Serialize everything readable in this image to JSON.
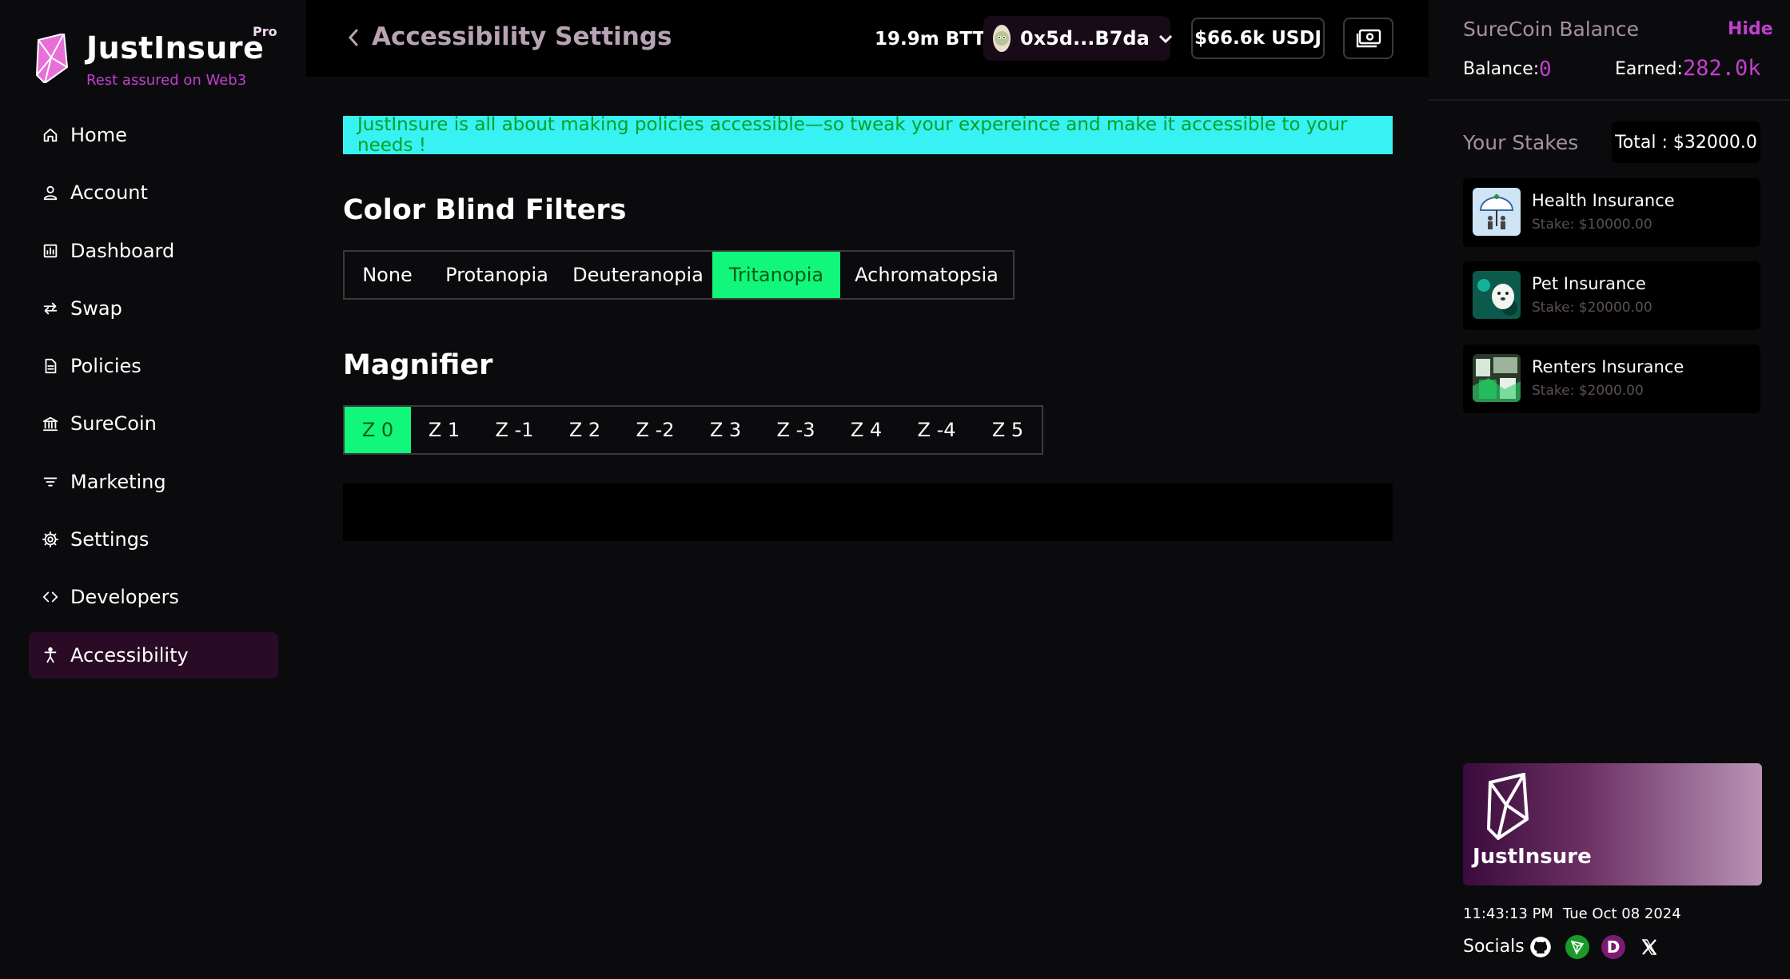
{
  "brand": {
    "name": "JustInsure",
    "badge": "Pro",
    "tagline": "Rest assured on Web3",
    "accent": "#c23fd0",
    "icon": "justinsure-logo-icon"
  },
  "sidebar": {
    "items": [
      {
        "label": "Home",
        "icon": "home-icon"
      },
      {
        "label": "Account",
        "icon": "user-icon"
      },
      {
        "label": "Dashboard",
        "icon": "dashboard-icon"
      },
      {
        "label": "Swap",
        "icon": "swap-icon"
      },
      {
        "label": "Policies",
        "icon": "document-icon"
      },
      {
        "label": "SureCoin",
        "icon": "bank-icon"
      },
      {
        "label": "Marketing",
        "icon": "filter-icon"
      },
      {
        "label": "Settings",
        "icon": "gear-icon"
      },
      {
        "label": "Developers",
        "icon": "code-icon"
      },
      {
        "label": "Accessibility",
        "icon": "accessibility-icon",
        "active": true
      }
    ]
  },
  "header": {
    "title": "Accessibility Settings",
    "btt_balance": "19.9m BTT",
    "wallet_address": "0x5d...B7da",
    "usdj_balance": "$66.6k USDJ"
  },
  "banner": {
    "text": "JustInsure is all about making policies accessible—so tweak your expereince and make it accessible to your needs !",
    "bg_color": "#38f1f3",
    "text_color": "#07a126"
  },
  "color_blind": {
    "title": "Color Blind Filters",
    "options": [
      "None",
      "Protanopia",
      "Deuteranopia",
      "Tritanopia",
      "Achromatopsia"
    ],
    "selected": "Tritanopia"
  },
  "magnifier": {
    "title": "Magnifier",
    "options": [
      "Z 0",
      "Z 1",
      "Z -1",
      "Z 2",
      "Z -2",
      "Z 3",
      "Z -3",
      "Z 4",
      "Z -4",
      "Z 5"
    ],
    "selected": "Z 0",
    "selected_color": "#11f77c"
  },
  "surecoin": {
    "title": "SureCoin Balance",
    "hide_label": "Hide",
    "balance_label": "Balance:",
    "balance_value": "0",
    "earned_label": "Earned:",
    "earned_value": "282.0k"
  },
  "stakes": {
    "title": "Your Stakes",
    "total": "Total : $32000.0",
    "items": [
      {
        "name": "Health Insurance",
        "amount": "Stake: $10000.00"
      },
      {
        "name": "Pet Insurance",
        "amount": "Stake: $20000.00"
      },
      {
        "name": "Renters Insurance",
        "amount": "Stake: $2000.00"
      }
    ]
  },
  "promo": {
    "name": "JustInsure"
  },
  "footer": {
    "time": "11:43:13 PM",
    "date": "Tue Oct 08 2024",
    "socials_label": "Socials",
    "socials": [
      "github-icon",
      "tron-icon",
      "d-icon",
      "x-icon"
    ]
  }
}
